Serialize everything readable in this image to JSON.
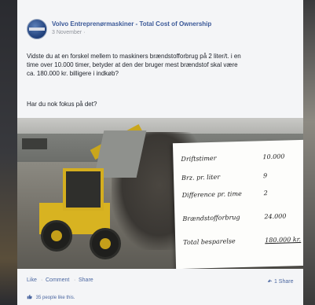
{
  "post": {
    "page_name": "Volvo Entreprenørmaskiner - Total Cost of Ownership",
    "date": "3 November ·",
    "text": "Vidste du at en forskel mellem to maskiners brændstofforbrug på 2 liter/t. i en\ntime over 10.000 timer, betyder at den der bruger mest brændstof skal være\nca. 180.000 kr. billigere i indkøb?",
    "question": "Har du nok fokus på det?",
    "handwritten_note": {
      "rows": [
        {
          "label": "Driftstimer",
          "value": "10.000"
        },
        {
          "label": "Brz. pr. liter",
          "value": "9"
        },
        {
          "label": "Difference pr. time",
          "value": "2"
        },
        {
          "label": "Brændstofforbrug",
          "value": "24.000"
        },
        {
          "label": "Total besparelse",
          "value": "180.000 kr."
        }
      ]
    }
  },
  "actions": {
    "like": "Like",
    "comment": "Comment",
    "share": "Share",
    "shares_count": "1 Share"
  },
  "likes": {
    "text": "35 people like this."
  },
  "colors": {
    "link": "#4b67a1",
    "page_name": "#3b5998",
    "loader_yellow": "#d8b321"
  }
}
